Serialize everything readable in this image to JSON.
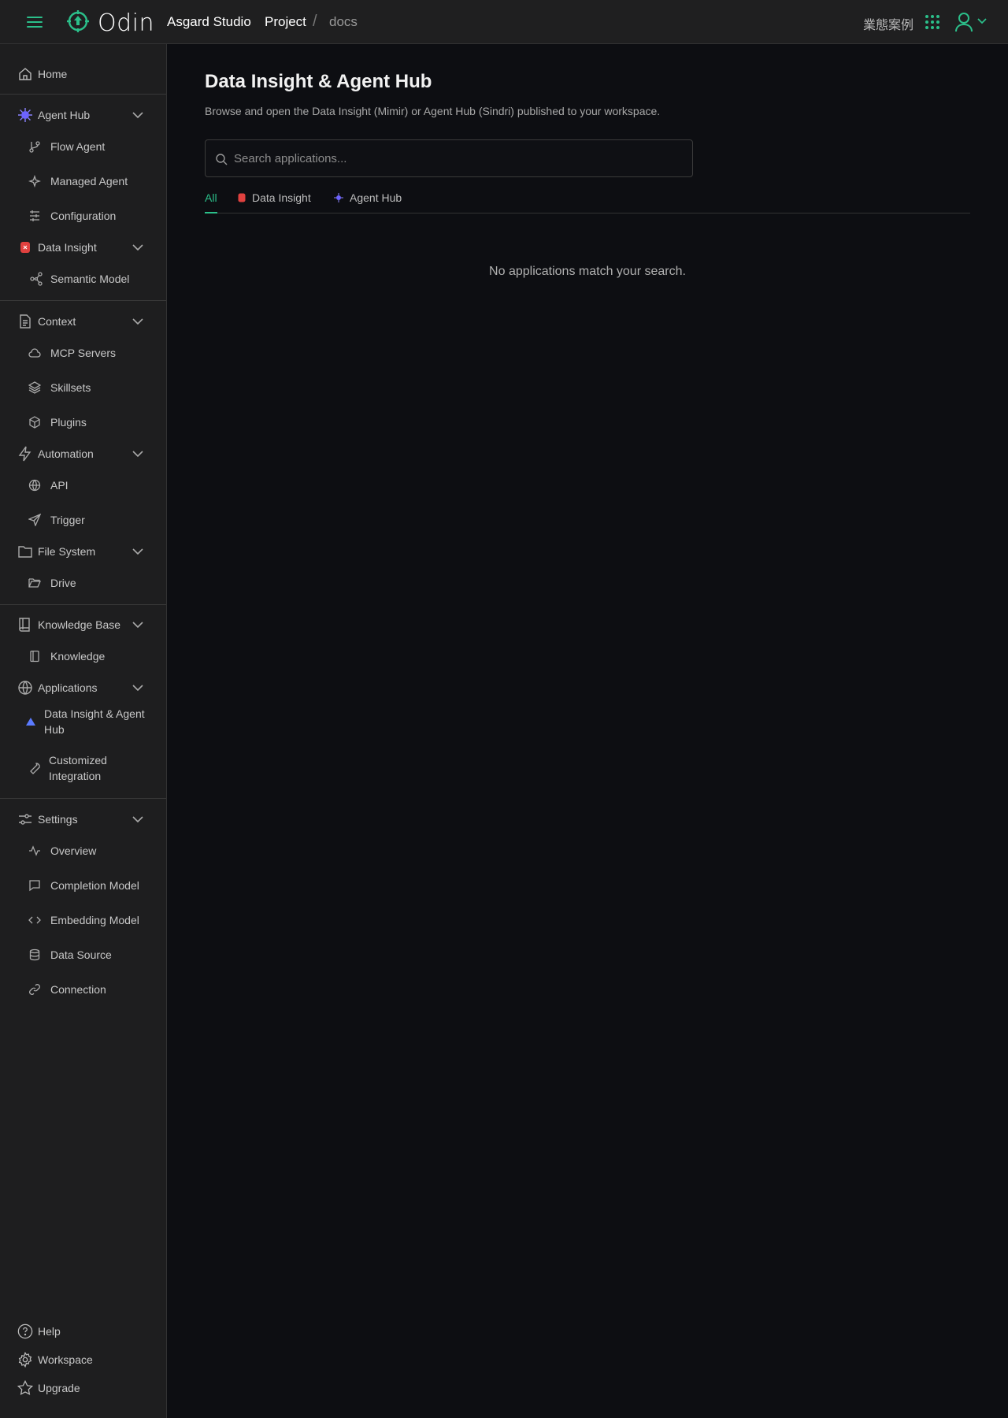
{
  "header": {
    "logo_text": "Odin",
    "studio": "Asgard Studio",
    "breadcrumb": {
      "project": "Project",
      "separator": "/",
      "current": "docs"
    },
    "case_link": "業態案例",
    "accent": "#2bbf8a"
  },
  "sidebar": {
    "home": "Home",
    "agent_hub": {
      "label": "Agent Hub",
      "items": [
        "Flow Agent",
        "Managed Agent",
        "Configuration"
      ]
    },
    "data_insight": {
      "label": "Data Insight",
      "items": [
        "Semantic Model"
      ]
    },
    "context": {
      "label": "Context",
      "items": [
        "MCP Servers",
        "Skillsets",
        "Plugins"
      ]
    },
    "automation": {
      "label": "Automation",
      "items": [
        "API",
        "Trigger"
      ]
    },
    "file_system": {
      "label": "File System",
      "items": [
        "Drive"
      ]
    },
    "knowledge_base": {
      "label": "Knowledge Base",
      "items": [
        "Knowledge"
      ]
    },
    "applications": {
      "label": "Applications",
      "items": [
        "Data Insight & Agent Hub",
        "Customized Integration"
      ]
    },
    "settings": {
      "label": "Settings",
      "items": [
        "Overview",
        "Completion Model",
        "Embedding Model",
        "Data Source",
        "Connection"
      ]
    },
    "footer": {
      "help": "Help",
      "workspace": "Workspace",
      "upgrade": "Upgrade"
    }
  },
  "main": {
    "title": "Data Insight & Agent Hub",
    "subtitle": "Browse and open the Data Insight (Mimir) or Agent Hub (Sindri) published to your workspace.",
    "search_placeholder": "Search applications...",
    "tabs": [
      "All",
      "Data Insight",
      "Agent Hub"
    ],
    "active_tab": "All",
    "empty_message": "No applications match your search."
  }
}
